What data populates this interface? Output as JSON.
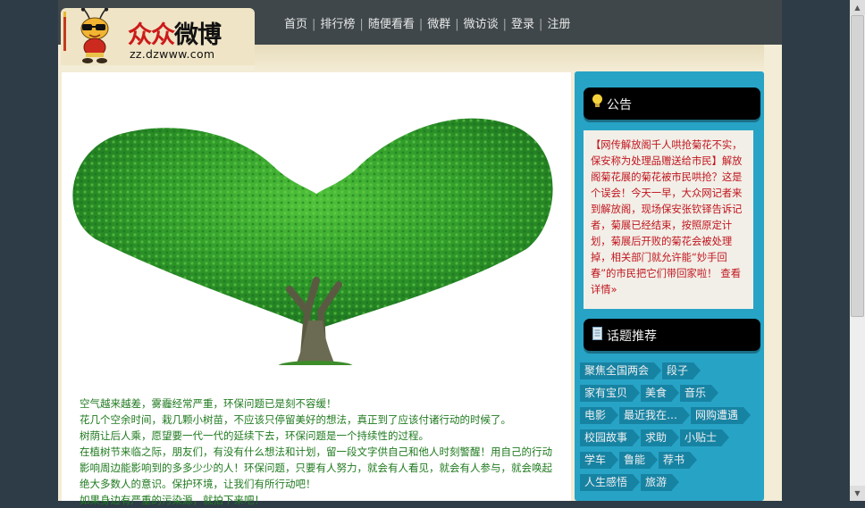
{
  "site": {
    "logo_text_red": "众众",
    "logo_text_black": "微博",
    "logo_url": "zz.dzwww.com"
  },
  "nav": {
    "items": [
      "首页",
      "排行榜",
      "随便看看",
      "微群",
      "微访谈",
      "登录",
      "注册"
    ]
  },
  "article": {
    "lines": [
      "空气越来越差，雾霾经常严重，环保问题已是刻不容缓！",
      "花几个空余时间，栽几颗小树苗，不应该只停留美好的想法，真正到了应该付诸行动的时候了。",
      "树荫让后人乘，愿望要一代一代的延续下去，环保问题是一个持续性的过程。",
      "在植树节来临之际，朋友们，有没有什么想法和计划，留一段文字供自己和他人时刻警醒！用自己的行动影响周边能影响到的多多少少的人！环保问题，只要有人努力，就会有人看见，就会有人参与，就会唤起绝大多数人的意识。保护环境，让我们有所行动吧！",
      "如果身边有严重的污染源，就拍下来吧！"
    ]
  },
  "sidebar": {
    "notice": {
      "title": "公告",
      "body": "【网传解放阁千人哄抢菊花不实，保安称为处理品赠送给市民】解放阁菊花展的菊花被市民哄抢？这是个误会！今天一早，大众网记者来到解放阁，现场保安张钦铎告诉记者，菊展已经结束，按照原定计划，菊展后开败的菊花会被处理掉，相关部门就允许能“妙手回春”的市民把它们带回家啦！",
      "link": "查看详情»"
    },
    "topics": {
      "title": "话题推荐",
      "rows": [
        [
          "聚焦全国两会",
          "段子"
        ],
        [
          "家有宝贝",
          "美食",
          "音乐"
        ],
        [
          "电影",
          "最近我在…",
          "网购遭遇"
        ],
        [
          "校园故事",
          "求助",
          "小贴士"
        ],
        [
          "学车",
          "鲁能",
          "荐书"
        ],
        [
          "人生感悟",
          "旅游"
        ]
      ]
    }
  },
  "colors": {
    "accent_green": "#1f7a1f",
    "notice_red": "#c0141c",
    "sidebar_blue": "#27a3c6",
    "tag_blue": "#1783a3"
  }
}
